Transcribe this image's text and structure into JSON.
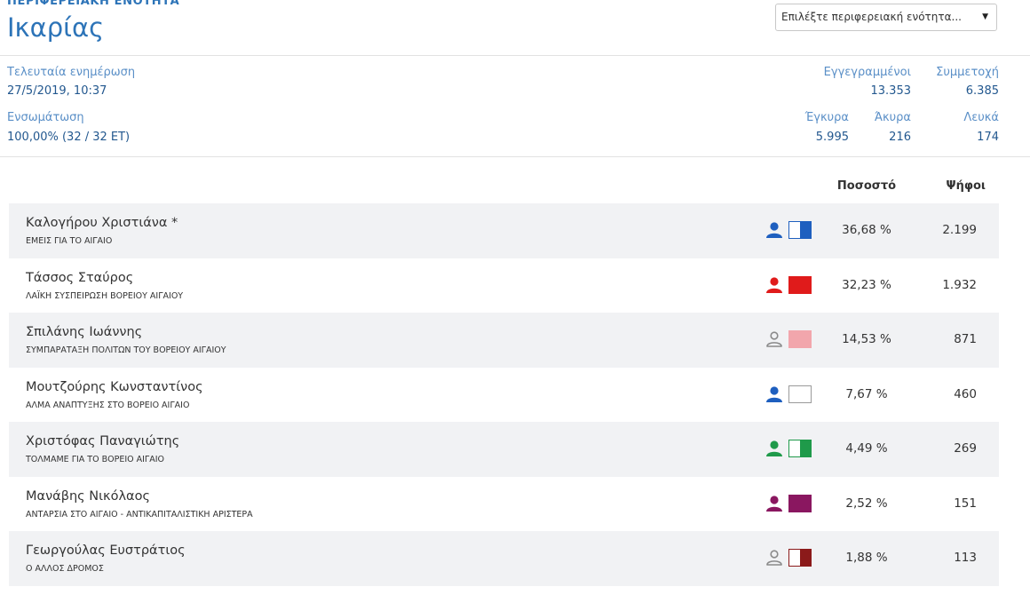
{
  "header": {
    "region_label": "ΠΕΡΙΦΕΡΕΙΑΚΗ ΕΝΟΤΗΤΑ",
    "region_name": "Ικαρίας",
    "select_value": "Επιλέξτε περιφερειακή ενότητα..."
  },
  "stats": {
    "last_update_label": "Τελευταία ενημέρωση",
    "last_update_value": "27/5/2019, 10:37",
    "integration_label": "Ενσωμάτωση",
    "integration_value": "100,00% (32 / 32 ΕΤ)",
    "registered_label": "Εγγεγραμμένοι",
    "registered_value": "13.353",
    "turnout_label": "Συμμετοχή",
    "turnout_value": "6.385",
    "valid_label": "Έγκυρα",
    "valid_value": "5.995",
    "invalid_label": "Άκυρα",
    "invalid_value": "216",
    "blank_label": "Λευκά",
    "blank_value": "174"
  },
  "table": {
    "percent_header": "Ποσοστό",
    "votes_header": "Ψήφοι",
    "rows": [
      {
        "name": "Καλογήρου Χριστιάνα *",
        "party": "ΕΜΕΙΣ ΓΙΑ ΤΟ ΑΙΓΑΙΟ",
        "percent": "36,68 %",
        "votes": "2.199",
        "icon_color": "#1e5fbf",
        "icon": "person-filled-icon",
        "swatch": [
          "#ffffff",
          "#1e5fbf"
        ]
      },
      {
        "name": "Τάσσος Σταύρος",
        "party": "ΛΑΪΚΗ ΣΥΣΠΕΙΡΩΣΗ ΒΟΡΕΙΟΥ ΑΙΓΑΙΟΥ",
        "percent": "32,23 %",
        "votes": "1.932",
        "icon_color": "#e01b1b",
        "icon": "person-filled-icon",
        "swatch": [
          "#e01b1b",
          "#e01b1b"
        ]
      },
      {
        "name": "Σπιλάνης Ιωάννης",
        "party": "ΣΥΜΠΑΡΑΤΑΞΗ ΠΟΛΙΤΩΝ ΤΟΥ ΒΟΡΕΙΟΥ ΑΙΓΑΙΟΥ",
        "percent": "14,53 %",
        "votes": "871",
        "icon_color": "#8a8a8a",
        "icon": "person-outline-icon",
        "swatch": [
          "#f2a6ac",
          "#f2a6ac"
        ]
      },
      {
        "name": "Μουτζούρης Κωνσταντίνος",
        "party": "ΑΛΜΑ ΑΝΑΠΤΥΞΗΣ ΣΤΟ ΒΟΡΕΙΟ ΑΙΓΑΙΟ",
        "percent": "7,67 %",
        "votes": "460",
        "icon_color": "#1e5fbf",
        "icon": "person-filled-icon",
        "swatch": [
          "#ffffff",
          "#ffffff"
        ]
      },
      {
        "name": "Χριστόφας Παναγιώτης",
        "party": "ΤΟΛΜΑΜΕ ΓΙΑ ΤΟ ΒΟΡΕΙΟ ΑΙΓΑΙΟ",
        "percent": "4,49 %",
        "votes": "269",
        "icon_color": "#1f9a4a",
        "icon": "person-filled-icon",
        "swatch": [
          "#ffffff",
          "#1f9a4a"
        ]
      },
      {
        "name": "Μανάβης Νικόλαος",
        "party": "ΑΝΤΑΡΣΙΑ ΣΤΟ ΑΙΓΑΙΟ - ΑΝΤΙΚΑΠΙΤΑΛΙΣΤΙΚΗ ΑΡΙΣΤΕΡΑ",
        "percent": "2,52 %",
        "votes": "151",
        "icon_color": "#8a1760",
        "icon": "person-filled-icon",
        "swatch": [
          "#8a1760",
          "#8a1760"
        ]
      },
      {
        "name": "Γεωργούλας Ευστράτιος",
        "party": "Ο ΑΛΛΟΣ ΔΡΟΜΟΣ",
        "percent": "1,88 %",
        "votes": "113",
        "icon_color": "#8a8a8a",
        "icon": "person-outline-icon",
        "swatch": [
          "#ffffff",
          "#8b1a1a"
        ]
      }
    ]
  }
}
